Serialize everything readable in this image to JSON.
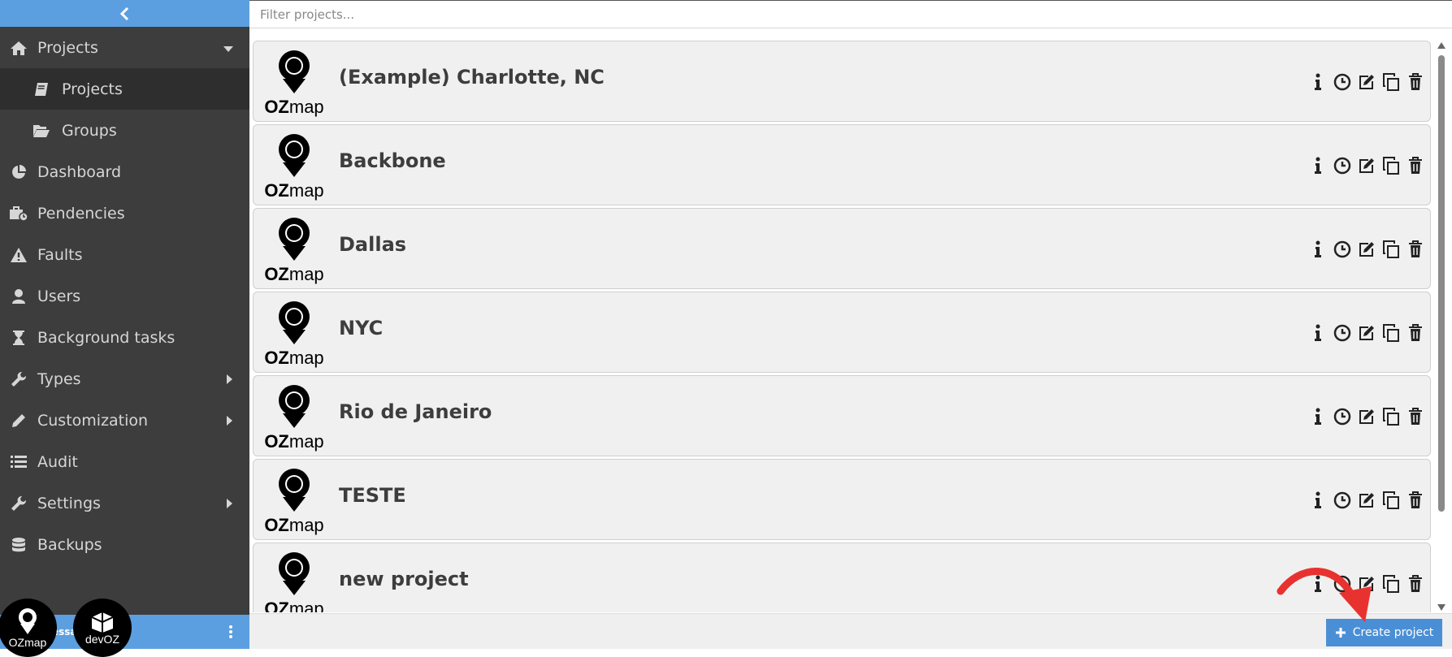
{
  "sidebar": {
    "items": [
      {
        "label": "Projects",
        "icon": "home-icon",
        "caret": "down"
      },
      {
        "label": "Projects",
        "icon": "book-icon",
        "sub": true,
        "active": true
      },
      {
        "label": "Groups",
        "icon": "folder-open-icon",
        "sub": true
      },
      {
        "label": "Dashboard",
        "icon": "pie-chart-icon"
      },
      {
        "label": "Pendencies",
        "icon": "briefcase-clock-icon"
      },
      {
        "label": "Faults",
        "icon": "warning-icon"
      },
      {
        "label": "Users",
        "icon": "user-icon"
      },
      {
        "label": "Background tasks",
        "icon": "hourglass-icon"
      },
      {
        "label": "Types",
        "icon": "wrench-icon",
        "caret": "right"
      },
      {
        "label": "Customization",
        "icon": "pencil-icon",
        "caret": "right"
      },
      {
        "label": "Audit",
        "icon": "list-icon"
      },
      {
        "label": "Settings",
        "icon": "wrench-icon",
        "caret": "right"
      },
      {
        "label": "Backups",
        "icon": "database-icon"
      }
    ],
    "footer": {
      "user": "essa... ator"
    }
  },
  "logos": {
    "ozmap": "OZmap",
    "devoz": "devOZ"
  },
  "filter": {
    "placeholder": "Filter projects..."
  },
  "projects": [
    {
      "name": "(Example) Charlotte, NC"
    },
    {
      "name": "Backbone"
    },
    {
      "name": "Dallas"
    },
    {
      "name": "NYC"
    },
    {
      "name": "Rio de Janeiro"
    },
    {
      "name": "TESTE"
    },
    {
      "name": "new project"
    }
  ],
  "project_logo_text": {
    "oz": "OZ",
    "map": "map"
  },
  "bottom": {
    "create_label": "Create project"
  },
  "colors": {
    "sidebar_bg": "#3d3d3d",
    "accent": "#5c9fe0",
    "button": "#4a8fd6",
    "annotation": "#e8322f"
  }
}
